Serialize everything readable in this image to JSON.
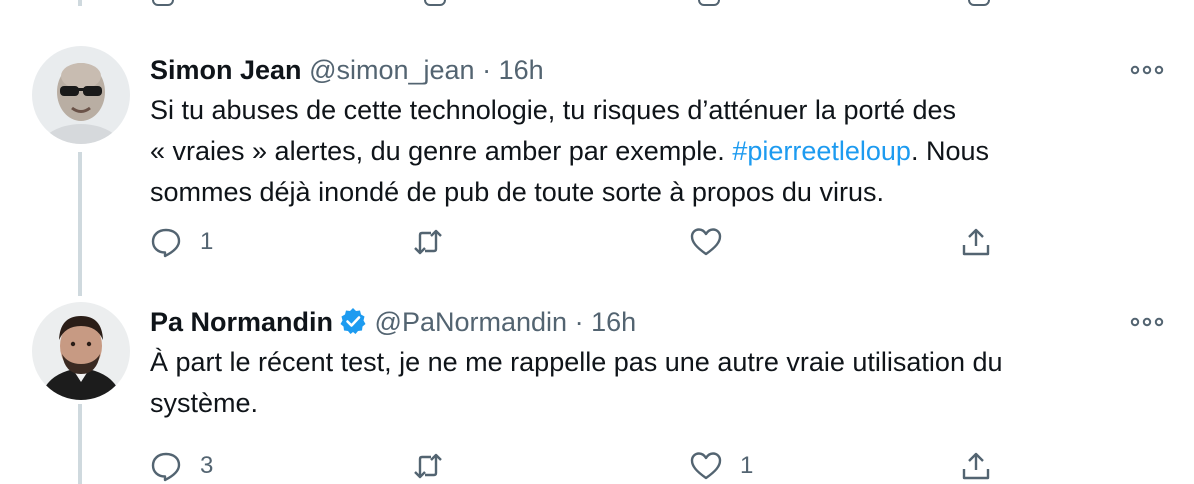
{
  "tweets": [
    {
      "name": "Simon Jean",
      "handle": "@simon_jean",
      "dot": "·",
      "time": "16h",
      "verified": false,
      "text": {
        "line1": "Si tu abuses de cette technologie, tu risques d’atténuer la porté des",
        "line2_before": "« vraies » alertes, du genre amber par exemple. ",
        "hashtag": "#pierreetleloup",
        "line2_after": ". Nous",
        "line3": "sommes déjà inondé de pub de toute sorte à propos du virus."
      },
      "reply_count": "1",
      "retweet_count": "",
      "like_count": ""
    },
    {
      "name": "Pa Normandin",
      "handle": "@PaNormandin",
      "dot": "·",
      "time": "16h",
      "verified": true,
      "text": {
        "line1": "À part le récent test, je ne me rappelle pas une autre vraie utilisation du",
        "line2": "système."
      },
      "reply_count": "3",
      "retweet_count": "",
      "like_count": "1"
    }
  ],
  "colors": {
    "text": "#0f1419",
    "secondary": "#536471",
    "link": "#1d9bf0",
    "verified": "#1d9bf0",
    "thread_line": "#cfd9de"
  },
  "icons": {
    "reply": "speech-bubble-icon",
    "retweet": "retweet-arrows-icon",
    "like": "heart-icon",
    "share": "share-upload-icon",
    "more": "ellipsis-icon",
    "verified": "verified-badge-icon"
  }
}
